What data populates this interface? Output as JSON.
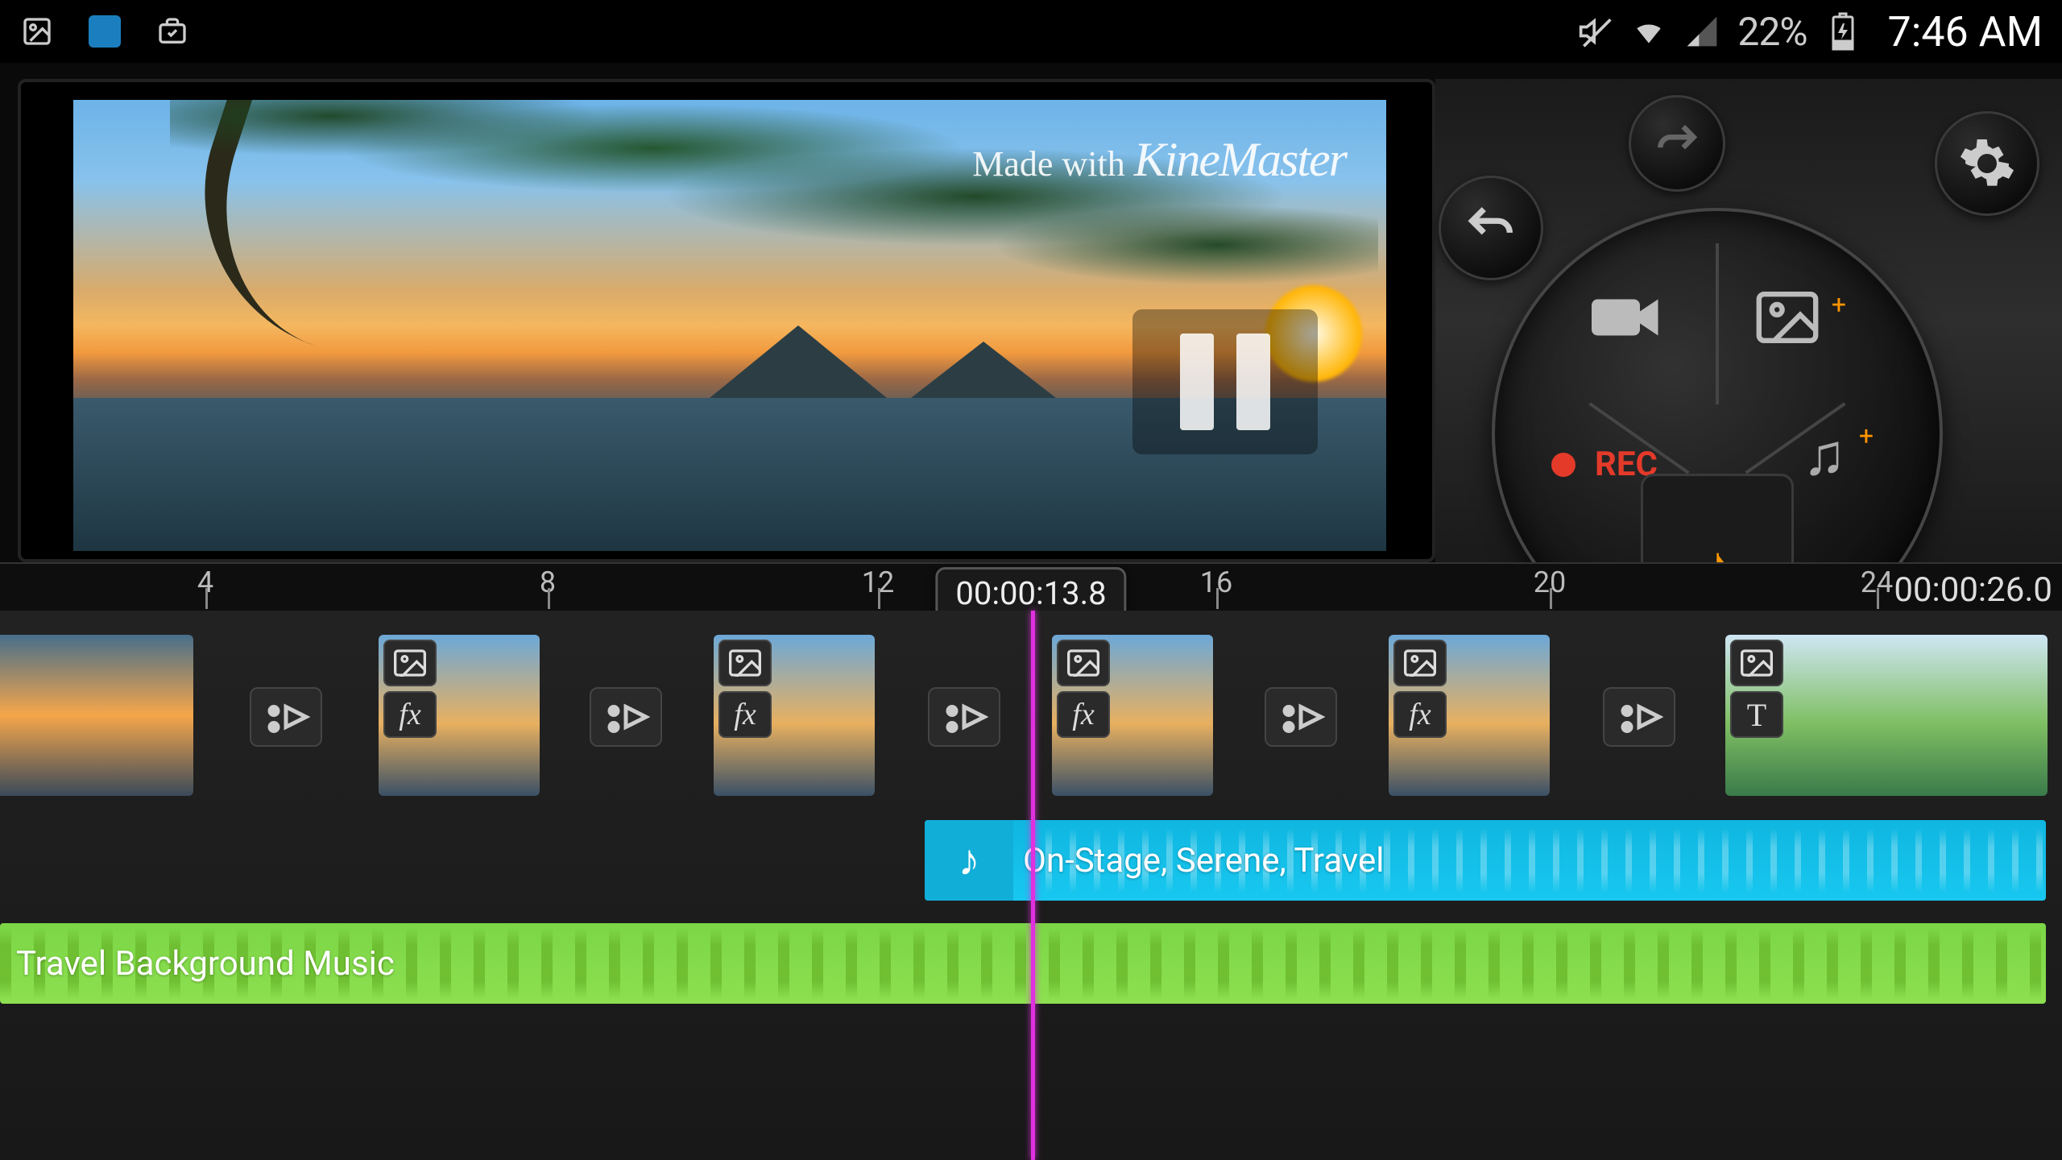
{
  "statusbar": {
    "battery": "22%",
    "time": "7:46 AM"
  },
  "preview": {
    "watermark_prefix": "Made with ",
    "watermark_app": "KineMaster"
  },
  "controls": {
    "rec_label": "REC"
  },
  "timeline": {
    "ticks": [
      "4",
      "8",
      "12",
      "16",
      "20",
      "24"
    ],
    "playhead_time": "00:00:13.8",
    "total_time": "00:00:26.0"
  },
  "clips": {
    "fx_label": "fx",
    "text_label": "T"
  },
  "audio": {
    "track1_title": "On-Stage, Serene, Travel",
    "track2_title": "Travel Background Music"
  }
}
